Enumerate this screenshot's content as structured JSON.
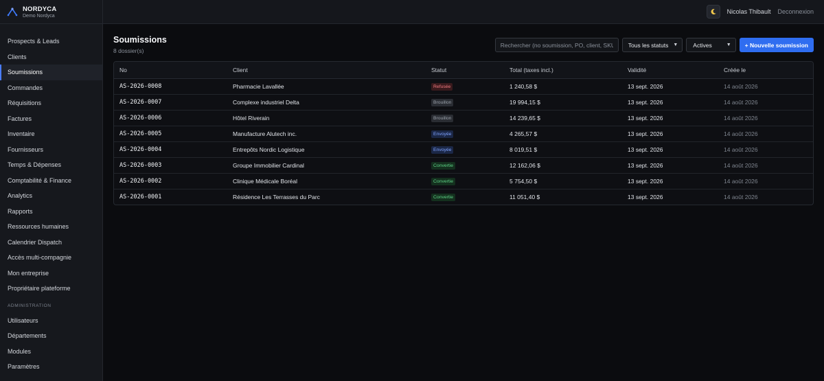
{
  "brand": {
    "name": "NORDYCA",
    "subtitle": "Demo Nordyca"
  },
  "sidebar": {
    "items": [
      {
        "label": "Prospects & Leads"
      },
      {
        "label": "Clients"
      },
      {
        "label": "Soumissions",
        "active": true
      },
      {
        "label": "Commandes"
      },
      {
        "label": "Réquisitions"
      },
      {
        "label": "Factures"
      },
      {
        "label": "Inventaire"
      },
      {
        "label": "Fournisseurs"
      },
      {
        "label": "Temps & Dépenses"
      },
      {
        "label": "Comptabilité & Finance"
      },
      {
        "label": "Analytics"
      },
      {
        "label": "Rapports"
      },
      {
        "label": "Ressources humaines"
      },
      {
        "label": "Calendrier Dispatch"
      },
      {
        "label": "Accès multi-compagnie"
      },
      {
        "label": "Mon entreprise"
      },
      {
        "label": "Propriétaire plateforme"
      }
    ],
    "admin_section": "ADMINISTRATION",
    "admin_items": [
      {
        "label": "Utilisateurs"
      },
      {
        "label": "Départements"
      },
      {
        "label": "Modules"
      },
      {
        "label": "Paramètres"
      }
    ]
  },
  "topbar": {
    "theme_icon": "moon-icon",
    "user_name": "Nicolas Thibault",
    "logout": "Deconnexion"
  },
  "page": {
    "title": "Soumissions",
    "count": "8 dossier(s)",
    "search_placeholder": "Rechercher (no soumission, PO, client, SKU)",
    "status_filter": "Tous les statuts",
    "active_filter": "Actives",
    "new_button": "+ Nouvelle soumission"
  },
  "table": {
    "columns": [
      "No",
      "Client",
      "Statut",
      "Total (taxes incl.)",
      "Validité",
      "Créée le"
    ],
    "rows": [
      {
        "no": "AS-2026-0008",
        "client": "Pharmacie Lavallée",
        "status": "Refusée",
        "status_key": "refusee",
        "total": "1 240,58 $",
        "validity": "13 sept. 2026",
        "created": "14 août 2026"
      },
      {
        "no": "AS-2026-0007",
        "client": "Complexe industriel Delta",
        "status": "Brouillon",
        "status_key": "brouillon",
        "total": "19 994,15 $",
        "validity": "13 sept. 2026",
        "created": "14 août 2026"
      },
      {
        "no": "AS-2026-0006",
        "client": "Hôtel Riverain",
        "status": "Brouillon",
        "status_key": "brouillon",
        "total": "14 239,65 $",
        "validity": "13 sept. 2026",
        "created": "14 août 2026"
      },
      {
        "no": "AS-2026-0005",
        "client": "Manufacture Alutech inc.",
        "status": "Envoyée",
        "status_key": "envoyee",
        "total": "4 265,57 $",
        "validity": "13 sept. 2026",
        "created": "14 août 2026"
      },
      {
        "no": "AS-2026-0004",
        "client": "Entrepôts Nordic Logistique",
        "status": "Envoyée",
        "status_key": "envoyee",
        "total": "8 019,51 $",
        "validity": "13 sept. 2026",
        "created": "14 août 2026"
      },
      {
        "no": "AS-2026-0003",
        "client": "Groupe Immobilier Cardinal",
        "status": "Convertie",
        "status_key": "convertie",
        "total": "12 162,06 $",
        "validity": "13 sept. 2026",
        "created": "14 août 2026"
      },
      {
        "no": "AS-2026-0002",
        "client": "Clinique Médicale Boréal",
        "status": "Convertie",
        "status_key": "convertie",
        "total": "5 754,50 $",
        "validity": "13 sept. 2026",
        "created": "14 août 2026"
      },
      {
        "no": "AS-2026-0001",
        "client": "Résidence Les Terrasses du Parc",
        "status": "Convertie",
        "status_key": "convertie",
        "total": "11 051,40 $",
        "validity": "13 sept. 2026",
        "created": "14 août 2026"
      }
    ]
  }
}
